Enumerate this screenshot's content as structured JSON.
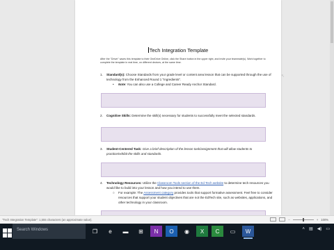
{
  "document": {
    "title": "Tech Integration Template",
    "intro": "After the \"Driver\" saves this template to their OneDrive Online, click the Share button in the upper right, and invite your teammate(s). Work together to complete the template in real time, on different devices, at the same time.",
    "sections": [
      {
        "number": "1.",
        "label": "Standard(s):",
        "text": " Choose Standards from your grade level or content area lesson that can be supported through the use of technology from the Enhanced Round 1 \"Ingredients\".",
        "note_label": "Note",
        "note_text": ": You can also use a College and Career Ready Anchor Standard."
      },
      {
        "number": "2.",
        "label": "Cognitive Skills:",
        "text": " Determine the skill(s) necessary for students to successfully meet the selected standards."
      },
      {
        "number": "3.",
        "label": "Student-Centered Task:",
        "text": " Give a brief description of the lesson task/assignment that will allow students to practice/exhibit the skills and standards."
      },
      {
        "number": "4.",
        "label": "Technology Resources:",
        "text_before_link": " Utilize the ",
        "link": "Classroom Tools section of the Ed Tech website",
        "text_after_link": " to determine tech resources you would like to build into your lesson and how you intend to use them.",
        "sub_before": "For example: The ",
        "sub_link": "Assessment category",
        "sub_after": " provides tools that support formative assessment. Feel free to consider resources that support your student objectives that are not the EdTech site, such as websites, applications, and other technology in your classroom."
      }
    ]
  },
  "statusbar": {
    "text": "\"Tech Integration Template\": 1,555 characters (an approximate value).",
    "zoom": "100%"
  },
  "taskbar": {
    "search_placeholder": "Search Windows",
    "apps": [
      {
        "icon": "task-view-icon",
        "glyph": "❐",
        "bg": "#101922"
      },
      {
        "icon": "edge-icon",
        "glyph": "e",
        "bg": "#101922"
      },
      {
        "icon": "file-explorer-icon",
        "glyph": "▬",
        "bg": "#101922"
      },
      {
        "icon": "store-icon",
        "glyph": "⊞",
        "bg": "#101922"
      },
      {
        "icon": "onenote-icon",
        "glyph": "N",
        "bg": "#7b2fa8"
      },
      {
        "icon": "outlook-icon",
        "glyph": "O",
        "bg": "#1b5fb0"
      },
      {
        "icon": "chrome-icon",
        "glyph": "◉",
        "bg": "#101922"
      },
      {
        "icon": "excel-icon",
        "glyph": "X",
        "bg": "#1f7a3e"
      },
      {
        "icon": "camtasia-icon",
        "glyph": "C",
        "bg": "#2b8a3e"
      },
      {
        "icon": "terminal-icon",
        "glyph": "▭",
        "bg": "#101922"
      },
      {
        "icon": "word-icon",
        "glyph": "W",
        "bg": "#2b579a",
        "active": true
      }
    ],
    "tray_icons": [
      "chevron-up-icon",
      "network-icon",
      "volume-icon",
      "notifications-icon"
    ]
  }
}
